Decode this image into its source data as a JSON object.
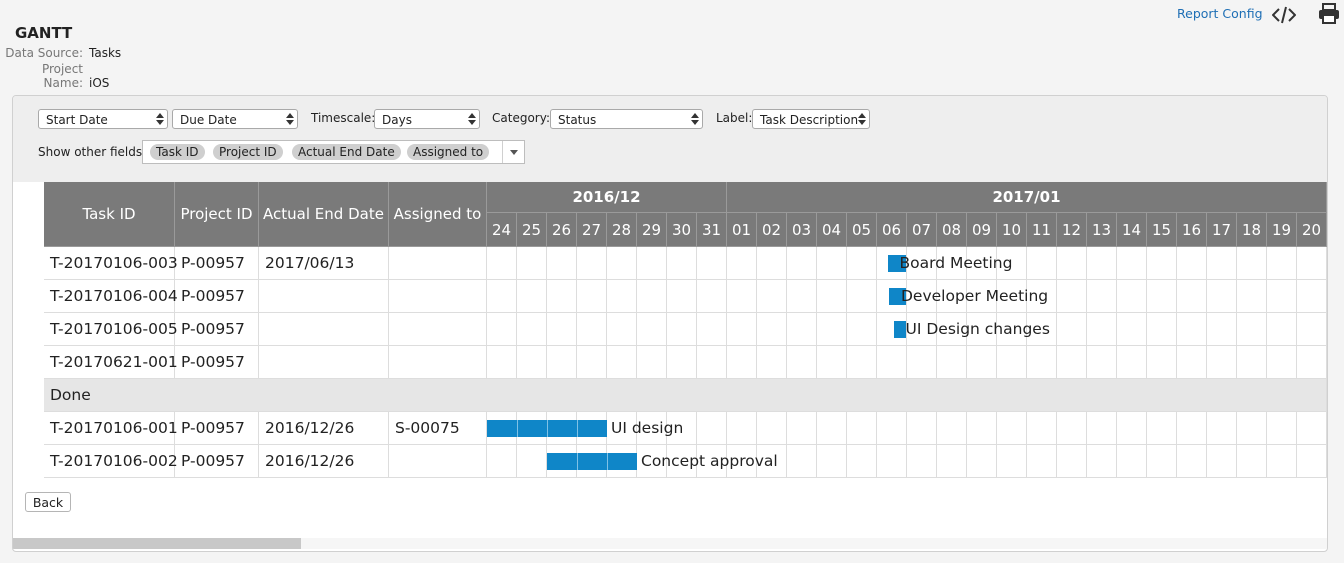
{
  "header": {
    "title": "GANTT",
    "data_source_label": "Data Source:",
    "data_source_value": "Tasks",
    "project_name_label": "Project Name:",
    "project_name_value": "iOS",
    "report_config": "Report Config",
    "code_icon": "code-icon",
    "print_icon": "printer-icon"
  },
  "controls": {
    "start_date": "Start Date",
    "due_date": "Due Date",
    "timescale_label": "Timescale:",
    "timescale_value": "Days",
    "category_label": "Category:",
    "category_value": "Status",
    "label_label": "Label:",
    "label_value": "Task Description",
    "show_other_fields_label": "Show other fields:",
    "fields": [
      "Task ID",
      "Project ID",
      "Actual End Date",
      "Assigned to"
    ]
  },
  "table": {
    "columns": [
      "Task ID",
      "Project ID",
      "Actual End Date",
      "Assigned to"
    ],
    "months": [
      "2016/12",
      "2017/01"
    ],
    "days": [
      "24",
      "25",
      "26",
      "27",
      "28",
      "29",
      "30",
      "31",
      "01",
      "02",
      "03",
      "04",
      "05",
      "06",
      "07",
      "08",
      "09",
      "10",
      "11",
      "12",
      "13",
      "14",
      "15",
      "16",
      "17",
      "18",
      "19",
      "20"
    ],
    "rows": [
      {
        "task_id": "T-20170106-003",
        "project_id": "P-00957",
        "actual_end": "2017/06/13",
        "assigned": "",
        "bar_label": "Board Meeting",
        "bar_start_day": 13.35,
        "bar_days": 0.6
      },
      {
        "task_id": "T-20170106-004",
        "project_id": "P-00957",
        "actual_end": "",
        "assigned": "",
        "bar_label": "Developer Meeting",
        "bar_start_day": 13.4,
        "bar_days": 0.55
      },
      {
        "task_id": "T-20170106-005",
        "project_id": "P-00957",
        "actual_end": "",
        "assigned": "",
        "bar_label": "UI Design changes",
        "bar_start_day": 13.55,
        "bar_days": 0.4
      },
      {
        "task_id": "T-20170621-001",
        "project_id": "P-00957",
        "actual_end": "",
        "assigned": ""
      },
      {
        "group": "Done"
      },
      {
        "task_id": "T-20170106-001",
        "project_id": "P-00957",
        "actual_end": "2016/12/26",
        "assigned": "S-00075",
        "bar_label": "UI design",
        "bar_start_day": 0,
        "bar_days": 4
      },
      {
        "task_id": "T-20170106-002",
        "project_id": "P-00957",
        "actual_end": "2016/12/26",
        "assigned": "",
        "bar_label": "Concept approval",
        "bar_start_day": 2,
        "bar_days": 3
      }
    ]
  },
  "footer": {
    "back": "Back"
  },
  "colors": {
    "bar": "#0f86c8",
    "header_bg": "#7a7a7a",
    "link": "#1f6fb5",
    "group_bg": "#e6e6e6"
  }
}
